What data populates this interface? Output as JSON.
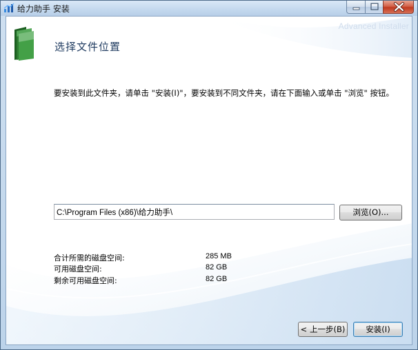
{
  "window": {
    "title": "给力助手 安装",
    "brand": "Advanced Installer"
  },
  "page": {
    "title": "选择文件位置",
    "instruction": "要安装到此文件夹，请单击 \"安装(I)\"，要安装到不同文件夹，请在下面输入或单击 \"浏览\" 按钮。"
  },
  "path": {
    "value": "C:\\Program Files (x86)\\给力助手\\"
  },
  "buttons": {
    "browse": "浏览(O)...",
    "back": "< 上一步(B)",
    "install": "安装(I)"
  },
  "disk": [
    {
      "label": "合计所需的磁盘空间:",
      "value": "285 MB"
    },
    {
      "label": "可用磁盘空间:",
      "value": "82 GB"
    },
    {
      "label": "剩余可用磁盘空间:",
      "value": "82 GB"
    }
  ],
  "icons": {
    "app": "app-logo-icon",
    "folder": "green-folder-icon",
    "minimize": "minimize-icon",
    "maximize": "maximize-icon",
    "close": "close-icon"
  },
  "colors": {
    "title_blue": "#1e3a5f",
    "close_red": "#c0391f",
    "folder_green": "#2e7d32"
  }
}
